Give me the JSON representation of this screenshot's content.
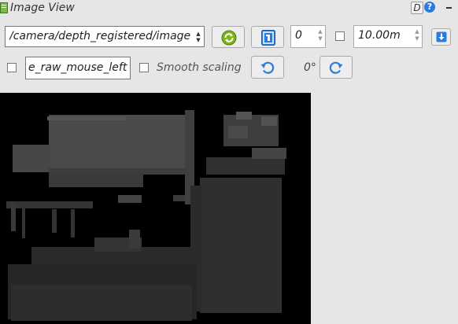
{
  "title": "Image View",
  "title_buttons": {
    "dock_label": "D",
    "help_label": "?"
  },
  "topic": {
    "value": "/camera/depth_registered/image"
  },
  "rotation_spin": {
    "value": "0"
  },
  "range_spin": {
    "value": "10.00m"
  },
  "mouse_topic": {
    "value": "e_raw_mouse_left"
  },
  "smooth_scaling": {
    "label": "Smooth scaling"
  },
  "rotation_label": "0°",
  "icons": {
    "window": "window-icon",
    "refresh": "refresh-icon",
    "save": "save-image-icon",
    "download": "download-icon",
    "rotate_left": "rotate-left-icon",
    "rotate_right": "rotate-right-icon"
  },
  "colors": {
    "accent_blue": "#2a7bde",
    "refresh_green": "#7cb518",
    "background": "#e6e6e6"
  }
}
